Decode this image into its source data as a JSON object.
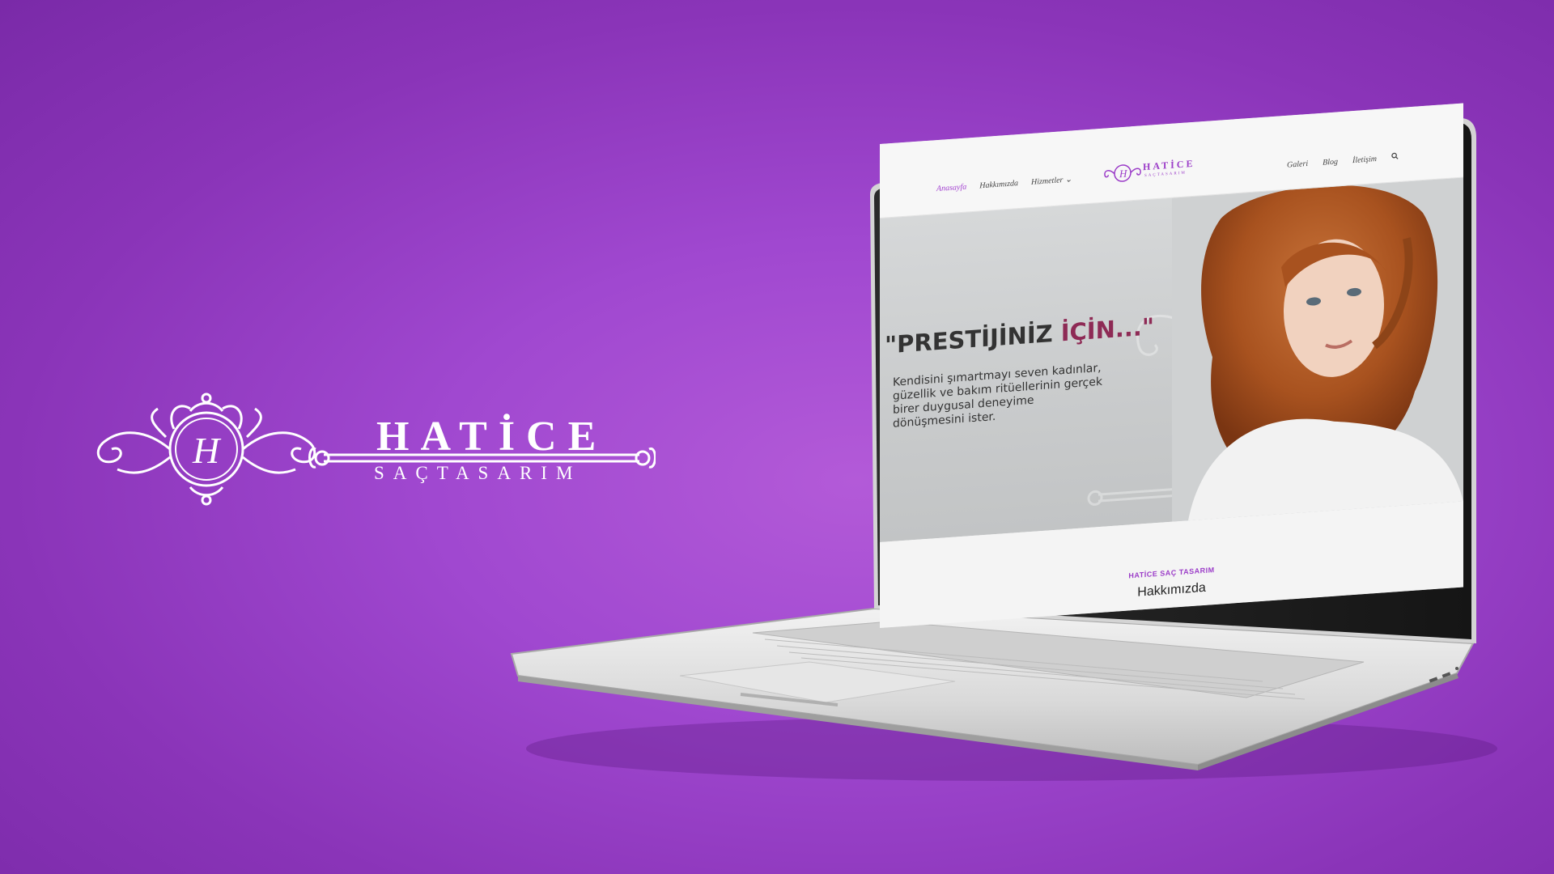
{
  "background": {
    "gradient_center": "#b35ad8",
    "gradient_edge": "#7a2aa8"
  },
  "brand": {
    "title": "HATİCE",
    "subtitle": "SAÇTASARIM",
    "monogram": "H",
    "color": "#ffffff"
  },
  "website": {
    "nav_left": [
      "Anasayfa",
      "Hakkımızda",
      "Hizmetler ⌄"
    ],
    "nav_right": [
      "Galeri",
      "Blog",
      "İletişim"
    ],
    "search_icon": "search-icon",
    "logo": {
      "title": "HATİCE",
      "subtitle": "SAÇTASARIM",
      "monogram": "H"
    },
    "accent_color": "#9b3cc8",
    "hero": {
      "headline_part1": "\"PRESTİJİNİZ ",
      "headline_part2": "İÇİN...\"",
      "headline_accent_color": "#8e2a55",
      "text_lines": [
        "Kendisini şımartmayı seven  kadınlar,",
        "güzellik ve bakım ritüellerinin gerçek",
        "birer duygusal deneyime",
        "dönüşmesini ister."
      ]
    },
    "section_label": "HATİCE SAÇ TASARIM",
    "section_heading": "Hakkımızda"
  }
}
